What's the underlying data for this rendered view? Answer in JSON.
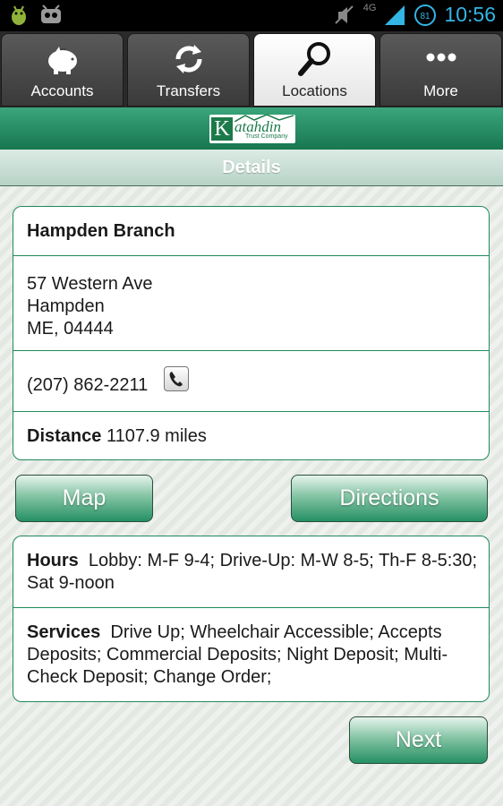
{
  "status_bar": {
    "time": "10:56",
    "network_label": "4G",
    "icons": [
      "android-debug-icon",
      "notification-app-icon",
      "mute-icon",
      "signal-icon",
      "battery-icon"
    ]
  },
  "tabs": [
    {
      "label": "Accounts",
      "icon": "piggy-bank-icon",
      "active": false
    },
    {
      "label": "Transfers",
      "icon": "transfer-arrows-icon",
      "active": false
    },
    {
      "label": "Locations",
      "icon": "search-icon",
      "active": true
    },
    {
      "label": "More",
      "icon": "more-dots-icon",
      "active": false
    }
  ],
  "brand": {
    "logo_letter": "K",
    "logo_word": "atahdin",
    "logo_sub": "Trust Company"
  },
  "header": {
    "title": "Details"
  },
  "location": {
    "name": "Hampden Branch",
    "address_line1": "57 Western Ave",
    "address_line2": "Hampden",
    "address_line3": "ME, 04444",
    "phone": "(207) 862-2211",
    "distance_label": "Distance",
    "distance_value": "1107.9 miles"
  },
  "actions": {
    "map_label": "Map",
    "directions_label": "Directions",
    "next_label": "Next"
  },
  "info": {
    "hours_label": "Hours",
    "hours_value": "Lobby: M-F 9-4; Drive-Up: M-W 8-5; Th-F 8-5:30; Sat 9-noon",
    "services_label": "Services",
    "services_value": "Drive Up; Wheelchair Accessible; Accepts Deposits; Commercial Deposits; Night Deposit; Multi-Check Deposit; Change Order;"
  },
  "colors": {
    "accent_green": "#1f8a5c",
    "status_blue": "#33b5e5"
  }
}
